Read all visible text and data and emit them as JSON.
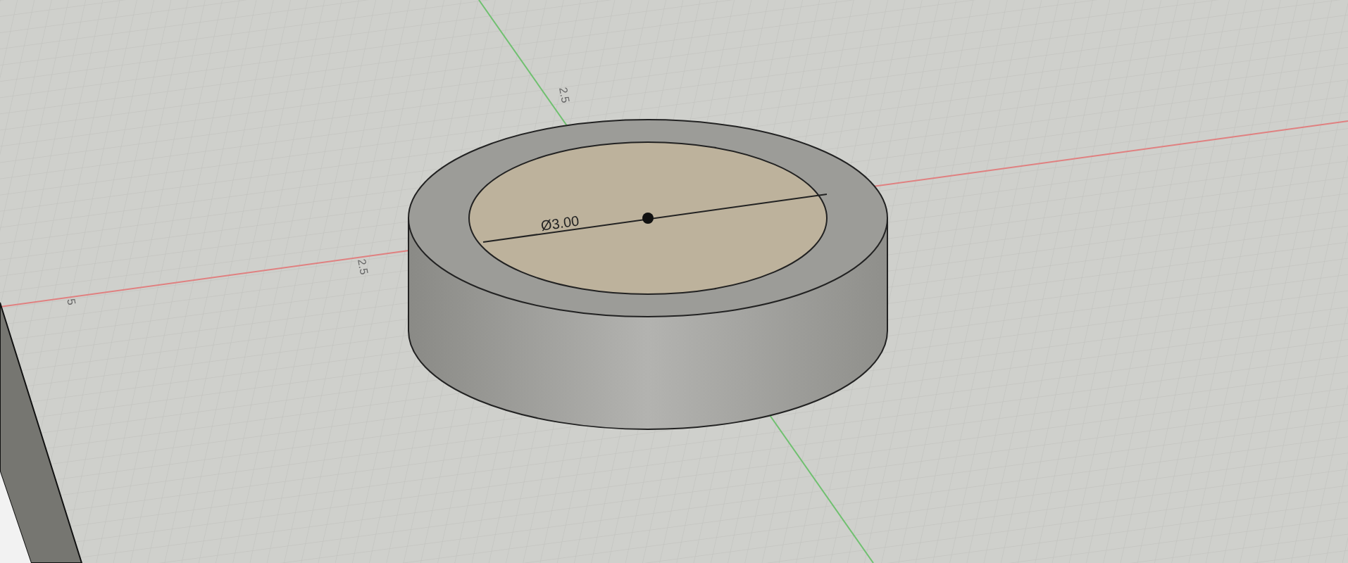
{
  "viewport": {
    "dimension": "Ø3.00",
    "grid_labels": [
      "2.5",
      "2.5",
      "5"
    ]
  }
}
